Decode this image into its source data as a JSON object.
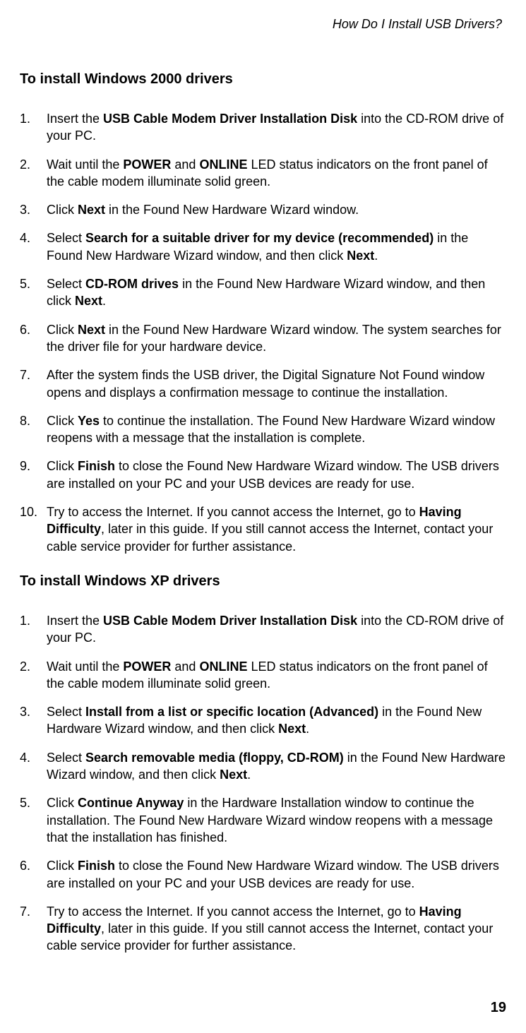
{
  "header": {
    "running_title": "How Do I Install USB Drivers?"
  },
  "section_a": {
    "heading": "To install Windows 2000 drivers",
    "steps": [
      {
        "n": "1.",
        "parts": [
          {
            "t": "Insert the "
          },
          {
            "t": "USB Cable Modem Driver Installation Disk",
            "b": true
          },
          {
            "t": " into the CD-ROM drive of your PC."
          }
        ]
      },
      {
        "n": "2.",
        "parts": [
          {
            "t": "Wait until the "
          },
          {
            "t": "POWER",
            "b": true
          },
          {
            "t": " and "
          },
          {
            "t": "ONLINE",
            "b": true
          },
          {
            "t": " LED status indicators on the front panel of the cable modem illuminate solid green."
          }
        ]
      },
      {
        "n": "3.",
        "parts": [
          {
            "t": "Click "
          },
          {
            "t": "Next",
            "b": true
          },
          {
            "t": " in the Found New Hardware Wizard window."
          }
        ]
      },
      {
        "n": "4.",
        "parts": [
          {
            "t": "Select "
          },
          {
            "t": "Search for a suitable driver for my device (recommended)",
            "b": true
          },
          {
            "t": " in the Found New Hardware Wizard window, and then click "
          },
          {
            "t": "Next",
            "b": true
          },
          {
            "t": "."
          }
        ]
      },
      {
        "n": "5.",
        "parts": [
          {
            "t": "Select "
          },
          {
            "t": "CD-ROM drives",
            "b": true
          },
          {
            "t": " in the Found New Hardware Wizard window, and then click "
          },
          {
            "t": "Next",
            "b": true
          },
          {
            "t": "."
          }
        ]
      },
      {
        "n": "6.",
        "parts": [
          {
            "t": "Click "
          },
          {
            "t": "Next",
            "b": true
          },
          {
            "t": " in the Found New Hardware Wizard window. The system searches for the driver file for your hardware device."
          }
        ]
      },
      {
        "n": "7.",
        "parts": [
          {
            "t": "After the system finds the USB driver, the Digital Signature Not Found window opens and displays a confirmation message to continue the installation."
          }
        ]
      },
      {
        "n": "8.",
        "parts": [
          {
            "t": "Click "
          },
          {
            "t": "Yes",
            "b": true
          },
          {
            "t": " to continue the installation. The Found New Hardware Wizard window reopens with a message that the installation is complete."
          }
        ]
      },
      {
        "n": "9.",
        "parts": [
          {
            "t": "Click "
          },
          {
            "t": "Finish",
            "b": true
          },
          {
            "t": " to close the Found New Hardware Wizard window. The USB drivers are installed on your PC and your USB devices are ready for use."
          }
        ]
      },
      {
        "n": "10.",
        "parts": [
          {
            "t": "Try to access the Internet. If you cannot access the Internet, go to "
          },
          {
            "t": "Having Difficulty",
            "b": true
          },
          {
            "t": ", later in this guide. If you still cannot access the Internet, contact your cable service provider for further assistance."
          }
        ]
      }
    ]
  },
  "section_b": {
    "heading": "To install Windows XP drivers",
    "steps": [
      {
        "n": "1.",
        "parts": [
          {
            "t": "Insert the "
          },
          {
            "t": "USB Cable Modem Driver Installation Disk",
            "b": true
          },
          {
            "t": " into the CD-ROM drive of your PC."
          }
        ]
      },
      {
        "n": "2.",
        "parts": [
          {
            "t": "Wait until the "
          },
          {
            "t": "POWER",
            "b": true
          },
          {
            "t": " and "
          },
          {
            "t": "ONLINE",
            "b": true
          },
          {
            "t": " LED status indicators on the front panel of the cable modem illuminate solid green."
          }
        ]
      },
      {
        "n": "3.",
        "parts": [
          {
            "t": "Select "
          },
          {
            "t": "Install from a list or specific location (Advanced)",
            "b": true
          },
          {
            "t": " in the Found New Hardware Wizard window, and then click "
          },
          {
            "t": "Next",
            "b": true
          },
          {
            "t": "."
          }
        ]
      },
      {
        "n": "4.",
        "parts": [
          {
            "t": "Select "
          },
          {
            "t": "Search removable media (floppy, CD-ROM)",
            "b": true
          },
          {
            "t": " in the Found New Hardware Wizard window, and then click "
          },
          {
            "t": "Next",
            "b": true
          },
          {
            "t": "."
          }
        ]
      },
      {
        "n": "5.",
        "parts": [
          {
            "t": "Click "
          },
          {
            "t": "Continue Anyway",
            "b": true
          },
          {
            "t": " in the Hardware Installation window to continue the installation. The Found New Hardware Wizard window reopens with a message that the installation has finished."
          }
        ]
      },
      {
        "n": "6.",
        "parts": [
          {
            "t": "Click "
          },
          {
            "t": "Finish",
            "b": true
          },
          {
            "t": " to close the Found New Hardware Wizard window. The USB drivers are installed on your PC and your USB devices are ready for use."
          }
        ]
      },
      {
        "n": "7.",
        "parts": [
          {
            "t": "Try to access the Internet. If you cannot access the Internet, go to "
          },
          {
            "t": "Having Difficulty",
            "b": true
          },
          {
            "t": ", later in this guide. If you still cannot access the Internet, contact your cable service provider for further assistance."
          }
        ]
      }
    ]
  },
  "footer": {
    "page_number": "19"
  }
}
